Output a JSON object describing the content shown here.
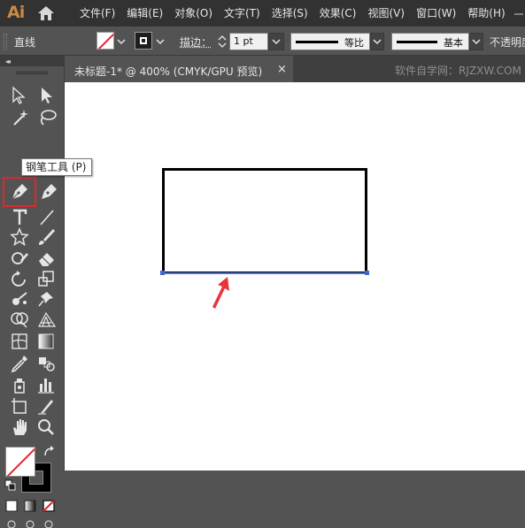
{
  "app": {
    "logo_text": "Ai",
    "brand_color": "#c98a46"
  },
  "menu": {
    "items": [
      "文件(F)",
      "编辑(E)",
      "对象(O)",
      "文字(T)",
      "选择(S)",
      "效果(C)",
      "视图(V)",
      "窗口(W)",
      "帮助(H)"
    ]
  },
  "control_bar": {
    "path_type": "直线",
    "stroke_label": "描边：",
    "stroke_weight": "1 pt",
    "profile_label": "等比",
    "brush_label": "基本",
    "opacity_label": "不透明度"
  },
  "document": {
    "tab_title": "未标题-1* @ 400% (CMYK/GPU 预览)",
    "close_glyph": "×",
    "watermark": "软件自学网：RJZXW.COM"
  },
  "tools": {
    "active_tool": "pen-icon",
    "tooltip": "钢笔工具 (P)",
    "highlight_color": "#e0262b"
  },
  "canvas": {
    "shape": "rectangle",
    "stroke_color": "#000000",
    "selection_color": "#4a6fd6",
    "arrow_color": "#e8343a"
  }
}
